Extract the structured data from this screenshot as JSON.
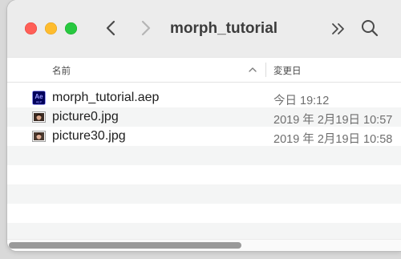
{
  "window": {
    "title": "morph_tutorial"
  },
  "toolbar": {
    "back_icon": "chevron-left-icon",
    "forward_icon": "chevron-right-icon",
    "more_icon": "double-chevron-right-icon",
    "search_icon": "search-icon"
  },
  "columns": {
    "name_label": "名前",
    "date_label": "変更日",
    "sort": "ascending"
  },
  "files": [
    {
      "name": "morph_tutorial.aep",
      "date": "今日 19:12",
      "icon": "after-effects-project-icon"
    },
    {
      "name": "picture0.jpg",
      "date": "2019 年 2月19日 10:57",
      "icon": "jpg-thumbnail-icon"
    },
    {
      "name": "picture30.jpg",
      "date": "2019 年 2月19日 10:58",
      "icon": "jpg-thumbnail-icon"
    }
  ],
  "colors": {
    "close": "#ff5f57",
    "minimize": "#febc2e",
    "maximize": "#28c840",
    "ae_icon_bg": "#00005b",
    "ae_icon_text": "#9999ff"
  }
}
